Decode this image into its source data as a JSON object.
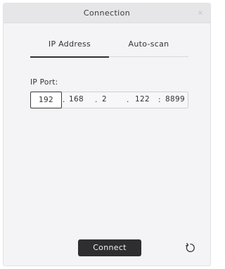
{
  "dialog": {
    "title": "Connection",
    "close_glyph": "×"
  },
  "tabs": [
    {
      "label": "IP Address",
      "active": true
    },
    {
      "label": "Auto-scan",
      "active": false
    }
  ],
  "ip": {
    "label": "IP Port:",
    "octets": [
      "192",
      "168",
      "2",
      "122"
    ],
    "dot": ".",
    "colon": ":",
    "port": "8899"
  },
  "actions": {
    "connect_label": "Connect",
    "refresh_icon": "refresh-icon"
  },
  "colors": {
    "button_bg": "#2e2e30",
    "dialog_bg": "#f4f4f6",
    "titlebar_bg": "#e6e6e9"
  }
}
